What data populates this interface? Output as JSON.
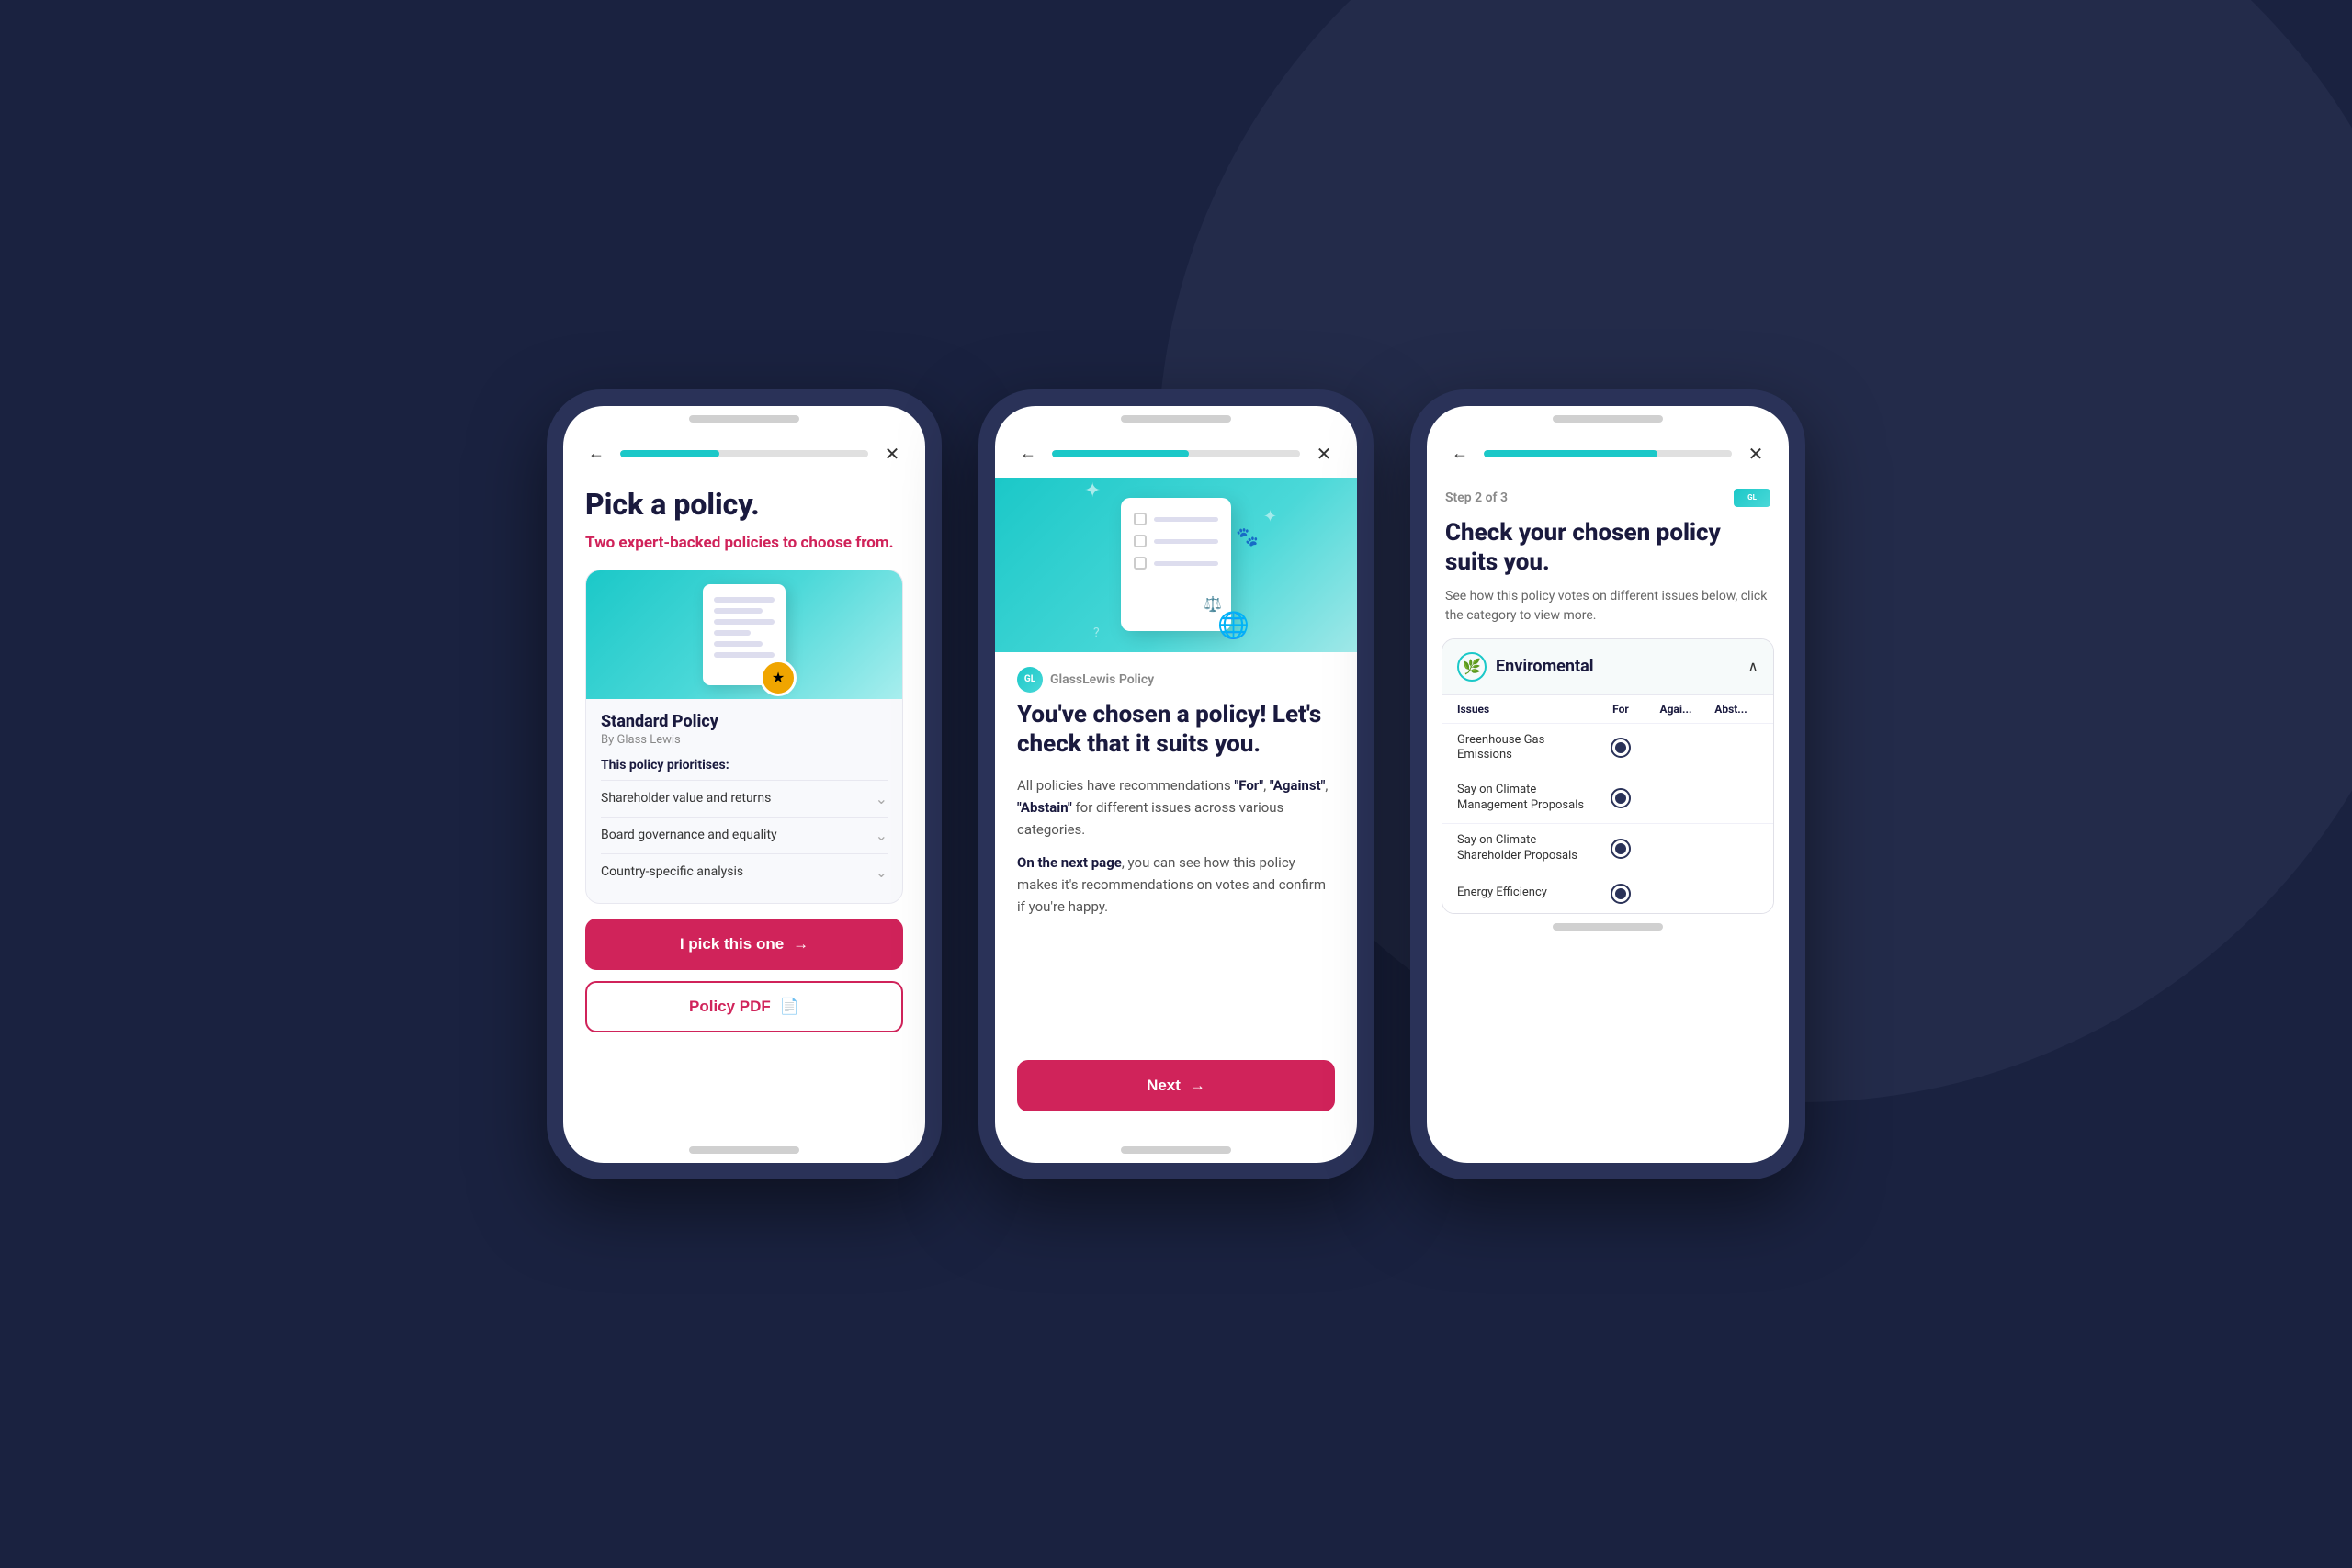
{
  "background": {
    "color": "#1a2240"
  },
  "phone1": {
    "progress": "40%",
    "title": "Pick a policy.",
    "subtitle": "Two expert-backed policies to choose from.",
    "card": {
      "policy_name": "Standard Policy",
      "policy_by": "By Glass Lewis",
      "prioritises_label": "This policy prioritises:",
      "items": [
        "Shareholder value and returns",
        "Board governance and equality",
        "Country-specific analysis"
      ]
    },
    "btn_pick": "I pick this one",
    "btn_pdf": "Policy PDF"
  },
  "phone2": {
    "progress": "55%",
    "logo_label": "GlassLewis Policy",
    "heading": "You've chosen a policy! Let's check that it suits you.",
    "body1": "All policies have recommendations \"For\", \"Against\", \"Abstain\" for different issues across various categories.",
    "body2": "On the next page, you can see how this policy makes it's recommendations on votes and confirm if you're happy.",
    "btn_next": "Next"
  },
  "phone3": {
    "progress": "70%",
    "step_label": "Step 2 of 3",
    "heading": "Check your chosen policy suits you.",
    "description": "See how this policy votes on different issues below, click the category to view more.",
    "environmental": {
      "label": "Enviromental",
      "columns": [
        "Issues",
        "For",
        "Agai...",
        "Abst..."
      ],
      "rows": [
        {
          "issue": "Greenhouse Gas Emissions",
          "for": true,
          "against": false,
          "abstain": false
        },
        {
          "issue": "Say on Climate Management Proposals",
          "for": true,
          "against": false,
          "abstain": false
        },
        {
          "issue": "Say on Climate Shareholder Proposals",
          "for": true,
          "against": false,
          "abstain": false
        },
        {
          "issue": "Energy Efficiency",
          "for": true,
          "against": false,
          "abstain": false
        }
      ]
    }
  }
}
